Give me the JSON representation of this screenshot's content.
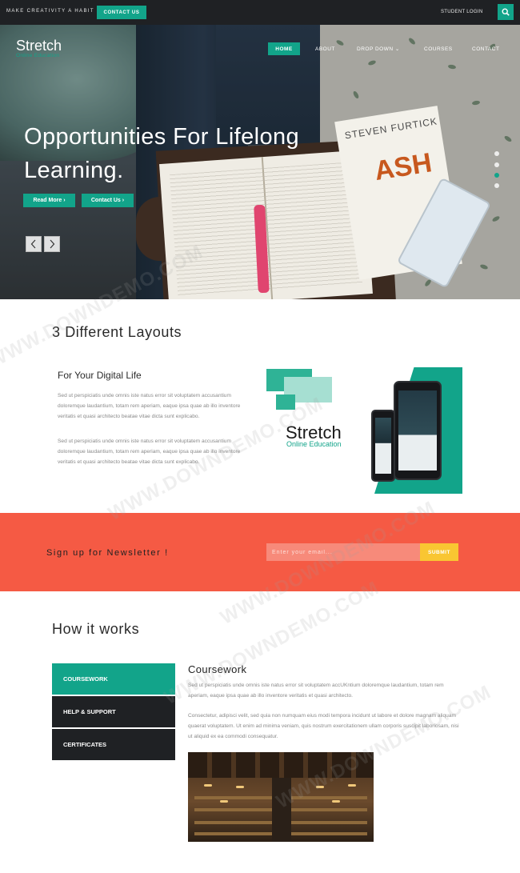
{
  "topbar": {
    "tagline": "MAKE CREATIVITY A HABIT",
    "contact_label": "CONTACT US",
    "student_login": "STUDENT LOGIN"
  },
  "brand": {
    "name": "Stretch",
    "subtitle": "Online Education"
  },
  "nav": {
    "items": [
      {
        "label": "HOME"
      },
      {
        "label": "ABOUT"
      },
      {
        "label": "DROP DOWN ⌄"
      },
      {
        "label": "COURSES"
      },
      {
        "label": "CONTACT"
      }
    ],
    "active_index": 0
  },
  "hero": {
    "title": "Opportunities For Lifelong Learning.",
    "buttons": {
      "read_more": "Read More ›",
      "contact": "Contact Us ›"
    },
    "book_author": "STEVEN FURTICK",
    "book_title": "ASH",
    "slides": 4,
    "active_slide": 2
  },
  "layouts": {
    "title": "3 Different Layouts",
    "subtitle": "For Your Digital Life",
    "para1": "Sed ut perspiciatis unde omnis iste natus error sit voluptatem accusantium doloremque laudantium, totam rem aperiam, eaque ipsa quae ab illo inventore veritatis et quasi architecto beatae vitae dicta sunt explicabo.",
    "para2": "Sed ut perspiciatis unde omnis iste natus error sit voluptatem accusantium doloremque laudantium, totam rem aperiam, eaque ipsa quae ab illo inventore veritatis et quasi architecto beatae vitae dicta sunt explicabo.",
    "promo_logo": "Stretch",
    "promo_sub": "Online Education"
  },
  "newsletter": {
    "title": "Sign up for Newsletter !",
    "placeholder": "Enter your email...",
    "submit": "SUBMIT"
  },
  "how": {
    "title": "How it works",
    "tabs": [
      {
        "label": "COURSEWORK"
      },
      {
        "label": "HELP & SUPPORT"
      },
      {
        "label": "CERTIFICATES"
      }
    ],
    "active_tab": 0,
    "content_title": "Coursework",
    "para1": "Sed ut perspiciatis unde omnis iste natus error sit voluptatem accUKntium doloremque laudantium, totam rem aperiam, eaque ipsa quae ab illo inventore veritatis et quasi architecto.",
    "para2": "Consectetur, adipisci velit, sed quia non numquam eius modi tempora incidunt ut labore et dolore magnam aliquam quaerat voluptatem. Ut enim ad minima veniam, quis nostrum exercitationem ullam corporis suscipit laboriosam, nisi ut aliquid ex ea commodi consequatur."
  },
  "watermark": "WWW.DOWNDEMO.COM",
  "colors": {
    "accent": "#12a48a",
    "dark": "#1f2124",
    "newsletter": "#f55a44",
    "submit": "#f9c632"
  }
}
